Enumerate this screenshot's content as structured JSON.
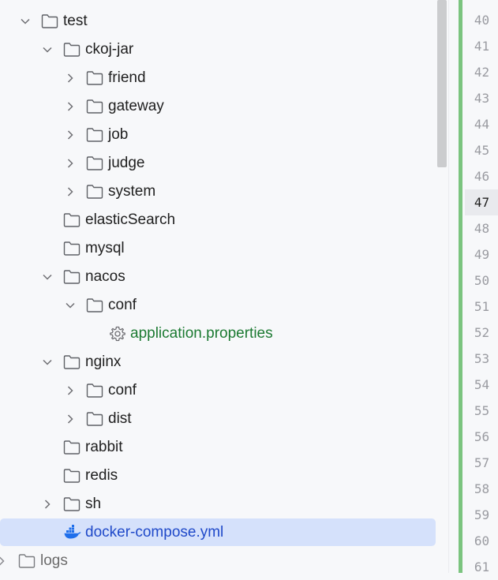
{
  "tree": {
    "items": [
      {
        "label": "test",
        "expanded": true,
        "chevron": "down"
      },
      {
        "label": "ckoj-jar",
        "expanded": true,
        "chevron": "down"
      },
      {
        "label": "friend",
        "chevron": "right"
      },
      {
        "label": "gateway",
        "chevron": "right"
      },
      {
        "label": "job",
        "chevron": "right"
      },
      {
        "label": "judge",
        "chevron": "right"
      },
      {
        "label": "system",
        "chevron": "right"
      },
      {
        "label": "elasticSearch",
        "chevron": "none"
      },
      {
        "label": "mysql",
        "chevron": "none"
      },
      {
        "label": "nacos",
        "expanded": true,
        "chevron": "down"
      },
      {
        "label": "conf",
        "expanded": true,
        "chevron": "down"
      },
      {
        "label": "application.properties",
        "icon": "gear-icon",
        "color": "#1c7a32"
      },
      {
        "label": "nginx",
        "expanded": true,
        "chevron": "down"
      },
      {
        "label": "conf",
        "chevron": "right"
      },
      {
        "label": "dist",
        "chevron": "right"
      },
      {
        "label": "rabbit",
        "chevron": "none"
      },
      {
        "label": "redis",
        "chevron": "none"
      },
      {
        "label": "sh",
        "chevron": "right"
      },
      {
        "label": "docker-compose.yml",
        "icon": "docker-icon",
        "selected": true,
        "color": "#1f49c9"
      },
      {
        "label": "logs",
        "chevron": "right"
      }
    ]
  },
  "gutter": {
    "line_numbers": [
      "40",
      "41",
      "42",
      "43",
      "44",
      "45",
      "46",
      "47",
      "48",
      "49",
      "50",
      "51",
      "52",
      "53",
      "54",
      "55",
      "56",
      "57",
      "58",
      "59",
      "60",
      "61"
    ],
    "current_line": "47"
  },
  "colors": {
    "selection": "#d5e1fb",
    "vcs_added": "#7bc47f",
    "properties_text": "#1c7a32",
    "docker_text": "#1f49c9"
  }
}
